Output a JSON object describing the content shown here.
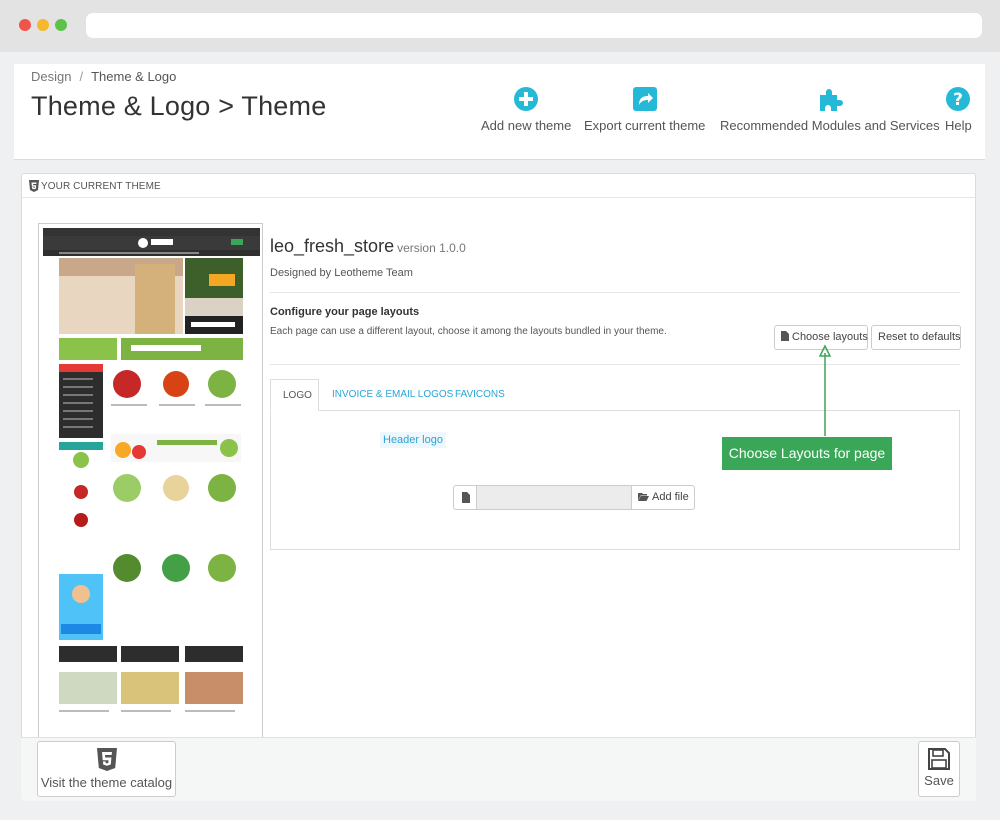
{
  "browser": {
    "url": ""
  },
  "breadcrumb": {
    "parent": "Design",
    "separator": "/",
    "current": "Theme & Logo"
  },
  "page_title": "Theme & Logo > Theme",
  "toolbar": {
    "add_label": "Add new theme",
    "export_label": "Export current theme",
    "recommended_label": "Recommended Modules and Services",
    "help_label": "Help",
    "icon_color": "#25b9d7"
  },
  "panel": {
    "heading": "YOUR CURRENT THEME"
  },
  "theme": {
    "name": "leo_fresh_store",
    "version": "version 1.0.0",
    "author": "Designed by Leotheme Team",
    "preview_alt": "leo_fresh_store theme preview"
  },
  "layouts": {
    "title": "Configure your page layouts",
    "description": "Each page can use a different layout, choose it among the layouts bundled in your theme.",
    "choose_label": "Choose layouts",
    "reset_label": "Reset to defaults"
  },
  "tabs": [
    {
      "label": "LOGO",
      "active": true
    },
    {
      "label": "INVOICE & EMAIL LOGOS",
      "active": false
    },
    {
      "label": "FAVICONS",
      "active": false
    }
  ],
  "logo_tab": {
    "header_logo_label": "Header logo",
    "file_value": "",
    "add_file_label": "Add file"
  },
  "annotation": {
    "text": "Choose Layouts for page",
    "color": "#3aa657"
  },
  "footer": {
    "catalog_label": "Visit the theme catalog",
    "save_label": "Save"
  }
}
